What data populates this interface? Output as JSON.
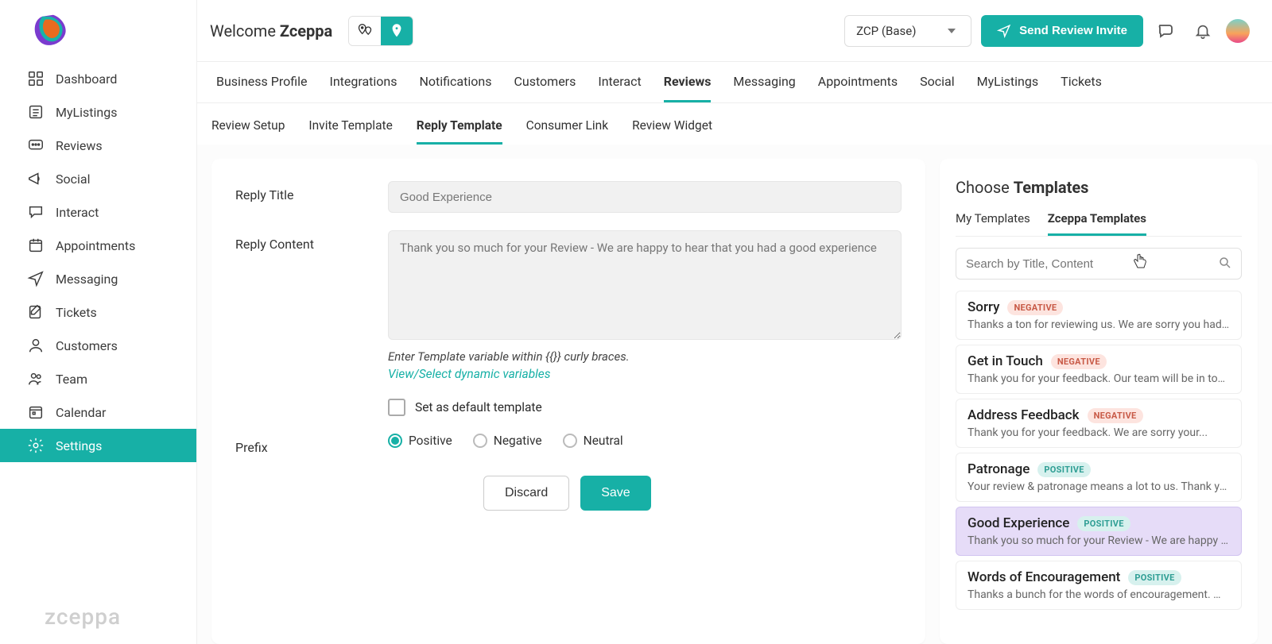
{
  "header": {
    "welcome_prefix": "Welcome ",
    "welcome_name": "Zceppa",
    "location_selected": "ZCP (Base)",
    "send_review_label": "Send Review Invite"
  },
  "sidebar": {
    "items": [
      {
        "label": "Dashboard",
        "icon": "grid"
      },
      {
        "label": "MyListings",
        "icon": "list"
      },
      {
        "label": "Reviews",
        "icon": "chat"
      },
      {
        "label": "Social",
        "icon": "megaphone"
      },
      {
        "label": "Interact",
        "icon": "bubble"
      },
      {
        "label": "Appointments",
        "icon": "calendar"
      },
      {
        "label": "Messaging",
        "icon": "send"
      },
      {
        "label": "Tickets",
        "icon": "edit"
      },
      {
        "label": "Customers",
        "icon": "user"
      },
      {
        "label": "Team",
        "icon": "users"
      },
      {
        "label": "Calendar",
        "icon": "cal2"
      },
      {
        "label": "Settings",
        "icon": "gear",
        "active": true
      }
    ],
    "brand_footer": "zceppa"
  },
  "tabs": {
    "items": [
      "Business Profile",
      "Integrations",
      "Notifications",
      "Customers",
      "Interact",
      "Reviews",
      "Messaging",
      "Appointments",
      "Social",
      "MyListings",
      "Tickets"
    ],
    "active": "Reviews"
  },
  "subtabs": {
    "items": [
      "Review Setup",
      "Invite Template",
      "Reply Template",
      "Consumer Link",
      "Review Widget"
    ],
    "active": "Reply Template"
  },
  "form": {
    "title_label": "Reply Title",
    "title_value": "Good Experience",
    "content_label": "Reply Content",
    "content_value": "Thank you so much for your Review - We are happy to hear that you had a good experience",
    "hint": "Enter Template variable within {{}} curly braces.",
    "dynamic_link": "View/Select dynamic variables",
    "default_label": "Set as default template",
    "default_checked": false,
    "prefix_label": "Prefix",
    "prefix_options": [
      "Positive",
      "Negative",
      "Neutral"
    ],
    "prefix_selected": "Positive",
    "discard_label": "Discard",
    "save_label": "Save"
  },
  "templates_panel": {
    "heading_prefix": "Choose ",
    "heading_bold": "Templates",
    "tabs": [
      "My Templates",
      "Zceppa Templates"
    ],
    "active_tab": "Zceppa Templates",
    "search_placeholder": "Search by Title, Content",
    "items": [
      {
        "title": "Sorry",
        "sentiment": "NEGATIVE",
        "desc": "Thanks a ton for reviewing us. We are sorry you had a ba..."
      },
      {
        "title": "Get in Touch",
        "sentiment": "NEGATIVE",
        "desc": "Thank you for your feedback. Our team will be in touch..."
      },
      {
        "title": "Address Feedback",
        "sentiment": "NEGATIVE",
        "desc": "Thank you for your feedback. We are sorry your..."
      },
      {
        "title": "Patronage",
        "sentiment": "POSITIVE",
        "desc": "Your review & patronage means a lot to us. Thank you!"
      },
      {
        "title": "Good Experience",
        "sentiment": "POSITIVE",
        "desc": "Thank you so much for your Review - We are happy to...",
        "selected": true
      },
      {
        "title": "Words of Encouragement",
        "sentiment": "POSITIVE",
        "desc": "Thanks a bunch for the words of encouragement. We lov..."
      }
    ]
  }
}
